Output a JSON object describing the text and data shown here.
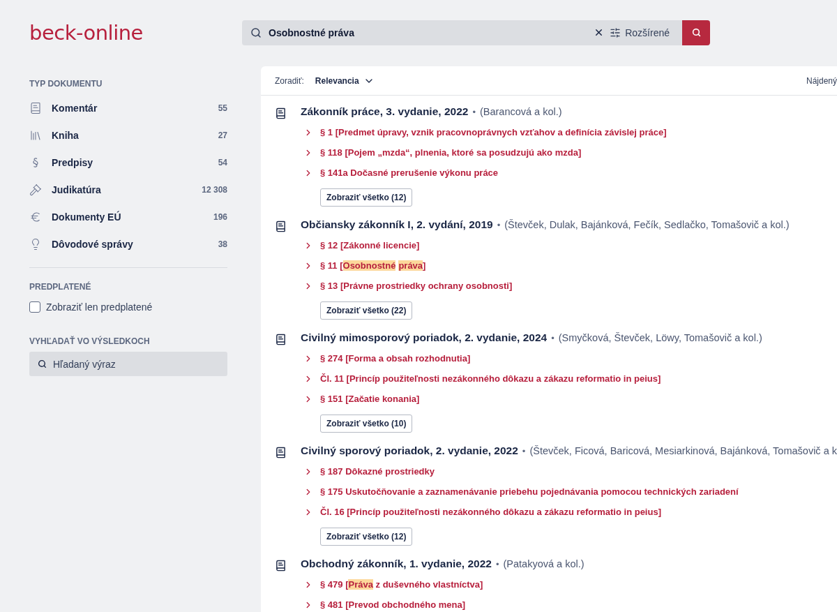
{
  "logo": "beck-online",
  "search": {
    "value": "Osobnostné práva",
    "advanced_label": "Rozšírené"
  },
  "sidebar": {
    "doc_type_heading": "TYP DOKUMENTU",
    "doc_types": [
      {
        "kind": "commentary",
        "label": "Komentár",
        "count": "55"
      },
      {
        "kind": "books",
        "label": "Kniha",
        "count": "27"
      },
      {
        "kind": "section",
        "label": "Predpisy",
        "count": "54"
      },
      {
        "kind": "gavel",
        "label": "Judikatúra",
        "count": "12 308"
      },
      {
        "kind": "euro",
        "label": "Dokumenty EÚ",
        "count": "196"
      },
      {
        "kind": "bulb",
        "label": "Dôvodové správy",
        "count": "38"
      }
    ],
    "subscribed_heading": "PREDPLATENÉ",
    "subscribed_checkbox": {
      "label": "Zobraziť len predplatené",
      "checked": false
    },
    "search_heading": "VYHĽADAŤ VO VÝSLEDKOCH",
    "search_placeholder": "Hľadaný výraz"
  },
  "results": {
    "sort_label": "Zoradiť:",
    "sort_value": "Relevancia",
    "found_label": "Nájdený",
    "items": [
      {
        "title": "Zákonník práce, 3. vydanie, 2022",
        "separator": "•",
        "authors": "(Barancová a kol.)",
        "links": [
          {
            "parts": [
              {
                "text": "§ 1 [Predmet úpravy, vznik pracovnoprávnych vzťahov a definícia závislej práce]",
                "highlighted": false
              }
            ]
          },
          {
            "parts": [
              {
                "text": "§ 118 [Pojem „mzda“, plnenia, ktoré sa posudzujú ako mzda]",
                "highlighted": false
              }
            ]
          },
          {
            "parts": [
              {
                "text": "§ 141a Dočasné prerušenie výkonu práce",
                "highlighted": false
              }
            ]
          }
        ],
        "show_all": "Zobraziť všetko (12)"
      },
      {
        "title": "Občiansky zákonník I, 2. vydání, 2019",
        "separator": "•",
        "authors": "(Števček, Dulak, Bajánková, Fečík, Sedlačko, Tomašovič a kol.)",
        "links": [
          {
            "parts": [
              {
                "text": "§ 12 [Zákonné licencie]",
                "highlighted": false
              }
            ]
          },
          {
            "parts": [
              {
                "text": "§ 11 [",
                "highlighted": false
              },
              {
                "text": "Osobnostné",
                "highlighted": true
              },
              {
                "text": "práva",
                "highlighted": true
              },
              {
                "text": "]",
                "highlighted": false
              }
            ]
          },
          {
            "parts": [
              {
                "text": "§ 13 [Právne prostriedky ochrany osobnosti]",
                "highlighted": false
              }
            ]
          }
        ],
        "show_all": "Zobraziť všetko (22)"
      },
      {
        "title": "Civilný mimosporový poriadok, 2. vydanie, 2024",
        "separator": "•",
        "authors": "(Smyčková, Števček, Löwy, Tomašovič a kol.)",
        "links": [
          {
            "parts": [
              {
                "text": "§ 274 [Forma a obsah rozhodnutia]",
                "highlighted": false
              }
            ]
          },
          {
            "parts": [
              {
                "text": "Čl. 11 [Princíp použiteľnosti nezákonného dôkazu a zákazu reformatio in peius]",
                "highlighted": false
              }
            ]
          },
          {
            "parts": [
              {
                "text": "§ 151 [Začatie konania]",
                "highlighted": false
              }
            ]
          }
        ],
        "show_all": "Zobraziť všetko (10)"
      },
      {
        "title": "Civilný sporový poriadok, 2. vydanie, 2022",
        "separator": "•",
        "authors": "(Števček, Ficová, Baricová, Mesiarkinová, Bajánková, Tomašovič a k",
        "links": [
          {
            "parts": [
              {
                "text": "§ 187 Dôkazné prostriedky",
                "highlighted": false
              }
            ]
          },
          {
            "parts": [
              {
                "text": "§ 175 Uskutočňovanie a zaznamenávanie priebehu pojednávania pomocou technických zariadení",
                "highlighted": false
              }
            ]
          },
          {
            "parts": [
              {
                "text": "Čl. 16 [Princíp použiteľnosti nezákonného dôkazu a zákazu reformatio in peius]",
                "highlighted": false
              }
            ]
          }
        ],
        "show_all": "Zobraziť všetko (12)"
      },
      {
        "title": "Obchodný zákonník, 1. vydanie, 2022",
        "separator": "•",
        "authors": "(Patakyová a kol.)",
        "links": [
          {
            "parts": [
              {
                "text": "§ 479 [",
                "highlighted": false
              },
              {
                "text": "Práva",
                "highlighted": true
              },
              {
                "text": " z duševného vlastníctva]",
                "highlighted": false
              }
            ]
          },
          {
            "parts": [
              {
                "text": "§ 481 [Prevod obchodného mena]",
                "highlighted": false
              }
            ]
          }
        ]
      }
    ]
  }
}
